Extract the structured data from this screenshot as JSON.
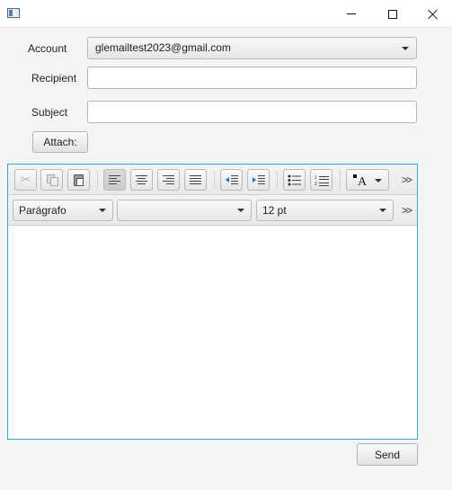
{
  "window": {
    "title": "",
    "controls": {
      "minimize_icon": "minimize-icon",
      "maximize_icon": "maximize-icon",
      "close_icon": "close-icon"
    }
  },
  "form": {
    "account_label": "Account",
    "account_value": "glemailtest2023@gmail.com",
    "recipient_label": "Recipient",
    "recipient_value": "",
    "subject_label": "Subject",
    "subject_value": "",
    "attach_label": "Attach:"
  },
  "editor": {
    "toolbar1": {
      "buttons": [
        "cut",
        "copy",
        "paste",
        "align-left",
        "align-center",
        "align-right",
        "align-justify",
        "outdent",
        "indent",
        "bullets",
        "numbers",
        "font-color"
      ],
      "selected": "align-left",
      "overflow": ">>"
    },
    "toolbar2": {
      "paragraph_format": "Parágrafo",
      "font_family": "",
      "font_size": "12 pt",
      "overflow": ">>"
    },
    "content": ""
  },
  "actions": {
    "send_label": "Send"
  }
}
